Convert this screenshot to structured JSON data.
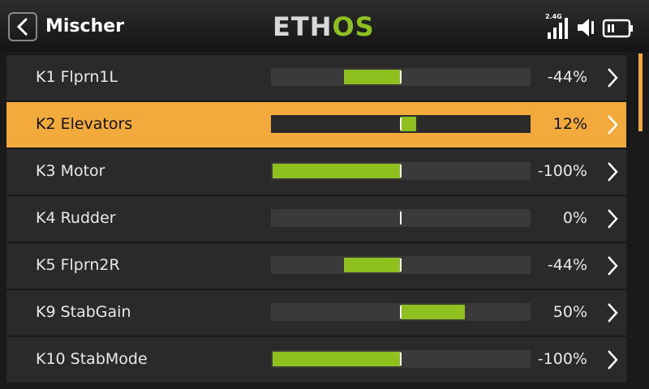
{
  "header": {
    "title": "Mischer",
    "brand_a": "ETH",
    "brand_b": "OS",
    "signal_label": "2.4G",
    "icons": [
      "back-icon",
      "signal-icon",
      "speaker-icon",
      "battery-icon"
    ]
  },
  "colors": {
    "accent": "#f2aa3c",
    "bar_fill": "#8ec11f",
    "row_bg": "#2a2a2a",
    "bar_bg": "#3a3a3a"
  },
  "mixes": [
    {
      "label": "K1 Flprn1L",
      "value": "-44%",
      "level": -44,
      "selected": false
    },
    {
      "label": "K2 Elevators",
      "value": "12%",
      "level": 12,
      "selected": true
    },
    {
      "label": "K3 Motor",
      "value": "-100%",
      "level": -100,
      "selected": false
    },
    {
      "label": "K4 Rudder",
      "value": "0%",
      "level": 0,
      "selected": false
    },
    {
      "label": "K5 Flprn2R",
      "value": "-44%",
      "level": -44,
      "selected": false
    },
    {
      "label": "K9 StabGain",
      "value": "50%",
      "level": 50,
      "selected": false
    },
    {
      "label": "K10 StabMode",
      "value": "-100%",
      "level": -100,
      "selected": false
    }
  ]
}
